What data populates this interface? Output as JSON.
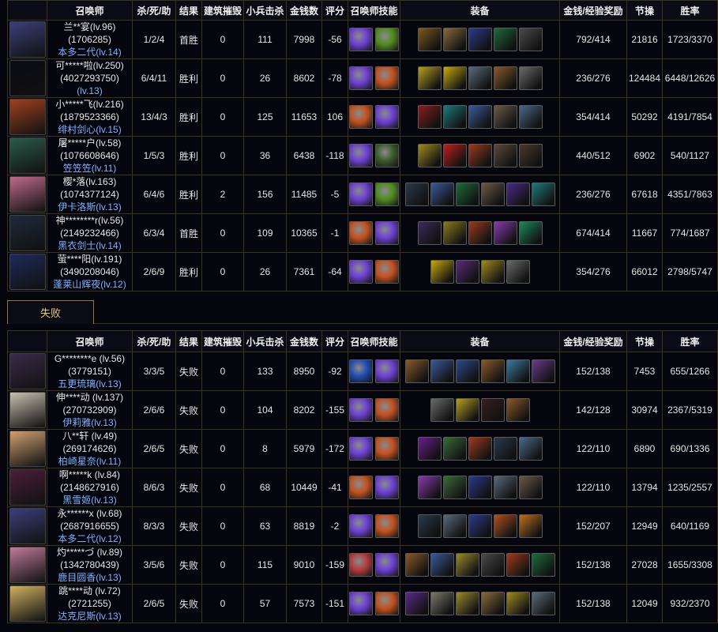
{
  "headers": {
    "summoner": "召唤师",
    "kda": "杀/死/助",
    "result": "结果",
    "buildings": "建筑摧毁",
    "minions": "小兵击杀",
    "gold": "金钱数",
    "score": "评分",
    "spells": "召唤师技能",
    "items": "装备",
    "rewards": "金钱/经验奖励",
    "integrity": "节操",
    "winrate": "胜率"
  },
  "loss_tab_label": "失败",
  "colors": {
    "border": "#3a3320",
    "accent": "#e7c87a",
    "level_blue": "#7fb2ff"
  },
  "win_rows": [
    {
      "name": "兰**宴(lv.96)",
      "id": "(1706285)",
      "champ": "本多二代(lv.14)",
      "kda": "1/2/4",
      "result": "首胜",
      "buildings": "0",
      "minions": "111",
      "gold": "7998",
      "score": "-56",
      "rewards": "792/414",
      "integrity": "21816",
      "winrate": "1723/3370",
      "avatar": "#3b3f7a",
      "spells": [
        {
          "icon": "purple-orb-icon",
          "c": "#6a3fd0"
        },
        {
          "icon": "green-leaf-icon",
          "c": "#4e8a1e"
        }
      ],
      "items": [
        {
          "icon": "gold-bug-icon",
          "c": "#7a5a1e"
        },
        {
          "icon": "shield-icon",
          "c": "#8a6a3a"
        },
        {
          "icon": "blue-blades-icon",
          "c": "#2a3a8a"
        },
        {
          "icon": "green-lantern-icon",
          "c": "#1e6a3a"
        },
        {
          "icon": "helm-icon",
          "c": "#4a4a4a"
        }
      ]
    },
    {
      "name": "可*****啦(lv.250)",
      "id": "(4027293750)",
      "champ": "(lv.13)",
      "kda": "6/4/11",
      "result": "胜利",
      "buildings": "0",
      "minions": "26",
      "gold": "8602",
      "score": "-78",
      "rewards": "236/276",
      "integrity": "124484",
      "winrate": "6448/12626",
      "avatar": "#0a0b14",
      "spells": [
        {
          "icon": "purple-orb-icon",
          "c": "#6a3fd0"
        },
        {
          "icon": "fire-icon",
          "c": "#c0501e"
        }
      ],
      "items": [
        {
          "icon": "gold-tome-icon",
          "c": "#b8a01e"
        },
        {
          "icon": "yellow-eye-icon",
          "c": "#c8a80e"
        },
        {
          "icon": "ring-icon",
          "c": "#5a6a7a"
        },
        {
          "icon": "bracelet-icon",
          "c": "#8a5a2a"
        },
        {
          "icon": "boots-icon",
          "c": "#6a6a6a"
        }
      ]
    },
    {
      "name": "小*****飞(lv.216)",
      "id": "(1879523366)",
      "champ": "绯村剑心(lv.15)",
      "kda": "13/4/3",
      "result": "胜利",
      "buildings": "0",
      "minions": "125",
      "gold": "11653",
      "score": "106",
      "rewards": "354/414",
      "integrity": "50292",
      "winrate": "4191/7854",
      "avatar": "#a0401e",
      "spells": [
        {
          "icon": "fire-icon",
          "c": "#c0501e"
        },
        {
          "icon": "purple-orb-icon",
          "c": "#6a3fd0"
        }
      ],
      "items": [
        {
          "icon": "red-spear-icon",
          "c": "#8a1e1e"
        },
        {
          "icon": "teal-blades-icon",
          "c": "#1e7a7a"
        },
        {
          "icon": "blue-boots-icon",
          "c": "#3a5a9a"
        },
        {
          "icon": "staff-icon",
          "c": "#6a5a4a"
        },
        {
          "icon": "feather-blade-icon",
          "c": "#4a6a8a"
        }
      ]
    },
    {
      "name": "屠*****户(lv.58)",
      "id": "(1076608646)",
      "champ": "笠笠笠(lv.11)",
      "kda": "1/5/3",
      "result": "胜利",
      "buildings": "0",
      "minions": "36",
      "gold": "6438",
      "score": "-118",
      "rewards": "440/512",
      "integrity": "6902",
      "winrate": "540/1127",
      "avatar": "#2a5a4a",
      "spells": [
        {
          "icon": "purple-orb-icon",
          "c": "#6a3fd0"
        },
        {
          "icon": "ghost-icon",
          "c": "#3a5a2a"
        }
      ],
      "items": [
        {
          "icon": "gold-chain-icon",
          "c": "#a08a1e"
        },
        {
          "icon": "red-gem-icon",
          "c": "#c01e1e"
        },
        {
          "icon": "red-blades-icon",
          "c": "#9a3a1e"
        },
        {
          "icon": "bow-icon",
          "c": "#5a4a3a"
        },
        {
          "icon": "lance-icon",
          "c": "#4a3a2a"
        }
      ]
    },
    {
      "name": "樱*落(lv.163)",
      "id": "(1074377124)",
      "champ": "伊卡洛斯(lv.13)",
      "kda": "6/4/6",
      "result": "胜利",
      "buildings": "2",
      "minions": "156",
      "gold": "11485",
      "score": "-5",
      "rewards": "236/276",
      "integrity": "67618",
      "winrate": "4351/7863",
      "avatar": "#c06a8a",
      "spells": [
        {
          "icon": "purple-orb-icon",
          "c": "#6a3fd0"
        },
        {
          "icon": "green-leaf-icon",
          "c": "#4e8a1e"
        }
      ],
      "items": [
        {
          "icon": "crossed-swords-icon",
          "c": "#2a3a4a"
        },
        {
          "icon": "blue-boots-icon",
          "c": "#3a5a9a"
        },
        {
          "icon": "green-lantern-icon",
          "c": "#1e6a3a"
        },
        {
          "icon": "staff-icon",
          "c": "#6a5a4a"
        },
        {
          "icon": "purple-sword-icon",
          "c": "#4a2a8a"
        },
        {
          "icon": "teal-blades-icon",
          "c": "#1e7a7a"
        }
      ]
    },
    {
      "name": "神********r(lv.56)",
      "id": "(2149232466)",
      "champ": "黑衣剑士(lv.14)",
      "kda": "6/3/4",
      "result": "首胜",
      "buildings": "0",
      "minions": "109",
      "gold": "10365",
      "score": "-1",
      "rewards": "674/414",
      "integrity": "11667",
      "winrate": "774/1687",
      "avatar": "#1e2a3a",
      "spells": [
        {
          "icon": "fire-icon",
          "c": "#c0501e"
        },
        {
          "icon": "purple-orb-icon",
          "c": "#6a3fd0"
        }
      ],
      "items": [
        {
          "icon": "black-blade-icon",
          "c": "#3a2a5a"
        },
        {
          "icon": "gold-rifle-icon",
          "c": "#8a7a1e"
        },
        {
          "icon": "red-blades-icon",
          "c": "#9a3a1e"
        },
        {
          "icon": "orb-ball-icon",
          "c": "#8a3ab0"
        },
        {
          "icon": "green-gem-icon",
          "c": "#1e8a5a"
        }
      ]
    },
    {
      "name": "萤****阳(lv.191)",
      "id": "(3490208046)",
      "champ": "蓬莱山辉夜(lv.12)",
      "kda": "2/6/9",
      "result": "胜利",
      "buildings": "0",
      "minions": "26",
      "gold": "7361",
      "score": "-64",
      "rewards": "354/276",
      "integrity": "66012",
      "winrate": "2798/5747",
      "avatar": "#1e2a5a",
      "spells": [
        {
          "icon": "purple-orb-icon",
          "c": "#6a3fd0"
        },
        {
          "icon": "fire-icon",
          "c": "#c0501e"
        }
      ],
      "items": [
        {
          "icon": "yellow-eye-icon",
          "c": "#c8a80e"
        },
        {
          "icon": "purple-lantern-icon",
          "c": "#5a2a7a"
        },
        {
          "icon": "gold-chain-icon",
          "c": "#a08a1e"
        },
        {
          "icon": "boots-icon",
          "c": "#6a6a6a"
        }
      ]
    }
  ],
  "loss_rows": [
    {
      "name": "G********e (lv.56)",
      "id": "(3779151)",
      "champ": "五更琉璃(lv.13)",
      "kda": "3/3/5",
      "result": "失败",
      "buildings": "0",
      "minions": "133",
      "gold": "8950",
      "score": "-92",
      "rewards": "152/138",
      "integrity": "7453",
      "winrate": "655/1266",
      "avatar": "#3a2a4a",
      "spells": [
        {
          "icon": "blue-flash-icon",
          "c": "#1e4ab0"
        },
        {
          "icon": "purple-orb-icon",
          "c": "#6a3fd0"
        }
      ],
      "items": [
        {
          "icon": "bracelet-icon",
          "c": "#8a5a2a"
        },
        {
          "icon": "blue-boots-icon",
          "c": "#3a5a9a"
        },
        {
          "icon": "blue-staff-icon",
          "c": "#2a4a8a"
        },
        {
          "icon": "bracelet-icon",
          "c": "#8a5a2a"
        },
        {
          "icon": "ice-blade-icon",
          "c": "#3a7aa0"
        },
        {
          "icon": "purple-scroll-icon",
          "c": "#6a3a8a"
        }
      ]
    },
    {
      "name": "伸****动 (lv.137)",
      "id": "(270732909)",
      "champ": "伊莉雅(lv.13)",
      "kda": "2/6/6",
      "result": "失败",
      "buildings": "0",
      "minions": "104",
      "gold": "8202",
      "score": "-155",
      "rewards": "142/128",
      "integrity": "30974",
      "winrate": "2367/5319",
      "avatar": "#c8c0b0",
      "spells": [
        {
          "icon": "purple-orb-icon",
          "c": "#6a3fd0"
        },
        {
          "icon": "fire-icon",
          "c": "#c0501e"
        }
      ],
      "items": [
        {
          "icon": "boots-icon",
          "c": "#6a6a6a"
        },
        {
          "icon": "gold-tome-icon",
          "c": "#b8a01e"
        },
        {
          "icon": "dark-blade-icon",
          "c": "#3a1e1e"
        },
        {
          "icon": "bracelet-icon",
          "c": "#8a5a2a"
        }
      ]
    },
    {
      "name": "八**轩 (lv.49)",
      "id": "(269174626)",
      "champ": "柏崎星奈(lv.11)",
      "kda": "2/6/5",
      "result": "失败",
      "buildings": "0",
      "minions": "8",
      "gold": "5979",
      "score": "-172",
      "rewards": "122/110",
      "integrity": "6890",
      "winrate": "690/1336",
      "avatar": "#d0a070",
      "spells": [
        {
          "icon": "purple-orb-icon",
          "c": "#6a3fd0"
        },
        {
          "icon": "fire-icon",
          "c": "#c0501e"
        }
      ],
      "items": [
        {
          "icon": "purple-lance-icon",
          "c": "#6a1e8a"
        },
        {
          "icon": "green-rifle-icon",
          "c": "#3a6a3a"
        },
        {
          "icon": "flame-sword-icon",
          "c": "#a03a1e"
        },
        {
          "icon": "crossed-swords-icon",
          "c": "#2a3a4a"
        },
        {
          "icon": "feather-blade-icon",
          "c": "#4a6a8a"
        }
      ]
    },
    {
      "name": "啊*****k (lv.84)",
      "id": "(2148627916)",
      "champ": "黑雪姬(lv.13)",
      "kda": "8/6/3",
      "result": "失败",
      "buildings": "0",
      "minions": "68",
      "gold": "10449",
      "score": "-41",
      "rewards": "122/110",
      "integrity": "13794",
      "winrate": "1235/2557",
      "avatar": "#4a1e3a",
      "spells": [
        {
          "icon": "fire-icon",
          "c": "#c0501e"
        },
        {
          "icon": "purple-orb-icon",
          "c": "#6a3fd0"
        }
      ],
      "items": [
        {
          "icon": "orb-ball-icon",
          "c": "#8a3ab0"
        },
        {
          "icon": "green-rifle-icon",
          "c": "#3a6a3a"
        },
        {
          "icon": "blue-blades-icon",
          "c": "#2a3a8a"
        },
        {
          "icon": "ring-icon",
          "c": "#5a6a7a"
        },
        {
          "icon": "staff-icon",
          "c": "#6a5a4a"
        }
      ]
    },
    {
      "name": "永******x (lv.68)",
      "id": "(2687916655)",
      "champ": "本多二代(lv.12)",
      "kda": "8/3/3",
      "result": "失败",
      "buildings": "0",
      "minions": "63",
      "gold": "8819",
      "score": "-2",
      "rewards": "152/207",
      "integrity": "12949",
      "winrate": "640/1169",
      "avatar": "#3b3f7a",
      "spells": [
        {
          "icon": "purple-orb-icon",
          "c": "#6a3fd0"
        },
        {
          "icon": "fire-icon",
          "c": "#c0501e"
        }
      ],
      "items": [
        {
          "icon": "crossed-swords-icon",
          "c": "#2a3a4a"
        },
        {
          "icon": "ring-icon",
          "c": "#5a6a7a"
        },
        {
          "icon": "blue-blades-icon",
          "c": "#2a3a8a"
        },
        {
          "icon": "fire-rune-icon",
          "c": "#b0501e"
        },
        {
          "icon": "flame-slash-icon",
          "c": "#c0701e"
        }
      ]
    },
    {
      "name": "灼*****づ (lv.89)",
      "id": "(1342780439)",
      "champ": "鹿目圆香(lv.13)",
      "kda": "3/5/6",
      "result": "失败",
      "buildings": "0",
      "minions": "115",
      "gold": "9010",
      "score": "-159",
      "rewards": "152/138",
      "integrity": "27028",
      "winrate": "1655/3308",
      "avatar": "#c07a9a",
      "spells": [
        {
          "icon": "heal-icon",
          "c": "#b03a3a"
        },
        {
          "icon": "purple-orb-icon",
          "c": "#6a3fd0"
        }
      ],
      "items": [
        {
          "icon": "bracelet-icon",
          "c": "#8a5a2a"
        },
        {
          "icon": "blue-boots-icon",
          "c": "#3a5a9a"
        },
        {
          "icon": "gold-wing-icon",
          "c": "#9a8a2a"
        },
        {
          "icon": "spiked-ring-icon",
          "c": "#4a4a4a"
        },
        {
          "icon": "flame-sword-icon",
          "c": "#a03a1e"
        },
        {
          "icon": "green-lantern-icon",
          "c": "#1e6a3a"
        }
      ]
    },
    {
      "name": "跳****动 (lv.72)",
      "id": "(2721255)",
      "champ": "达克尼斯(lv.13)",
      "kda": "2/6/5",
      "result": "失败",
      "buildings": "0",
      "minions": "57",
      "gold": "7573",
      "score": "-151",
      "rewards": "152/138",
      "integrity": "12049",
      "winrate": "932/2370",
      "avatar": "#d0b060",
      "spells": [
        {
          "icon": "purple-orb-icon",
          "c": "#6a3fd0"
        },
        {
          "icon": "fire-icon",
          "c": "#c0501e"
        }
      ],
      "items": [
        {
          "icon": "purple-scythe-icon",
          "c": "#5a2a8a"
        },
        {
          "icon": "armor-icon",
          "c": "#7a7a6a"
        },
        {
          "icon": "gold-wing-icon",
          "c": "#9a8a2a"
        },
        {
          "icon": "shield-icon",
          "c": "#8a6a3a"
        },
        {
          "icon": "gold-chain-icon",
          "c": "#a08a1e"
        },
        {
          "icon": "ring-icon",
          "c": "#5a6a7a"
        }
      ]
    }
  ]
}
